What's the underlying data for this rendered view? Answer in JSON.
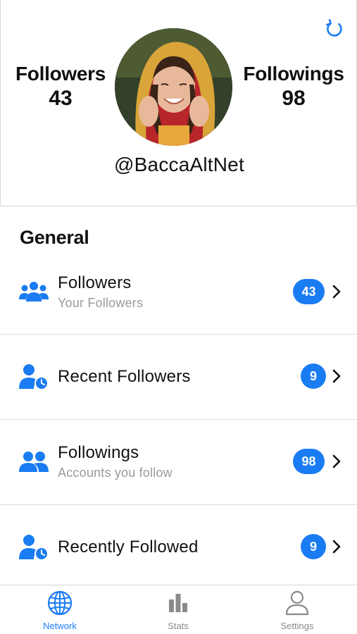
{
  "colors": {
    "accent": "#1a7cf2",
    "muted": "#9a9a9a",
    "inactive_tab": "#8a8a8a"
  },
  "header": {
    "refresh_icon": "refresh-icon",
    "followers_label": "Followers",
    "followers_count": "43",
    "followings_label": "Followings",
    "followings_count": "98",
    "handle": "@BaccaAltNet"
  },
  "section_title": "General",
  "rows": [
    {
      "icon": "users-group-icon",
      "title": "Followers",
      "subtitle": "Your Followers",
      "badge": "43"
    },
    {
      "icon": "user-clock-icon",
      "title": "Recent Followers",
      "subtitle": "",
      "badge": "9"
    },
    {
      "icon": "users-icon",
      "title": "Followings",
      "subtitle": "Accounts you follow",
      "badge": "98"
    },
    {
      "icon": "user-clock-icon",
      "title": "Recently Followed",
      "subtitle": "",
      "badge": "9"
    }
  ],
  "tabs": [
    {
      "icon": "globe-icon",
      "label": "Network",
      "active": true
    },
    {
      "icon": "bar-chart-icon",
      "label": "Stats",
      "active": false
    },
    {
      "icon": "person-icon",
      "label": "Settings",
      "active": false
    }
  ]
}
